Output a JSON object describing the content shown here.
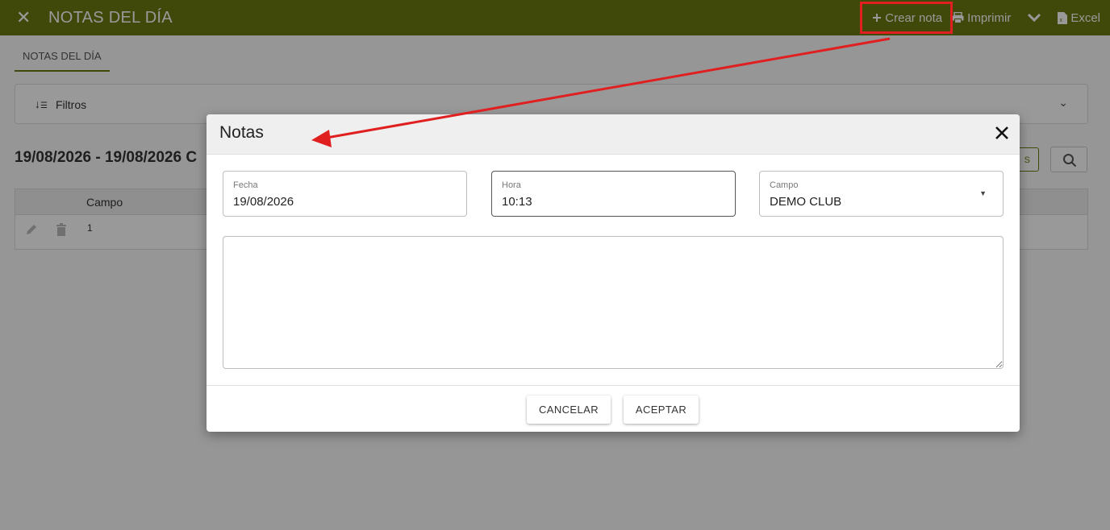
{
  "topbar": {
    "close_glyph": "✕",
    "title": "NOTAS DEL DÍA",
    "actions": [
      {
        "icon": "plus-icon",
        "label": "Crear nota"
      },
      {
        "icon": "printer-icon",
        "label": "Imprimir"
      },
      {
        "icon": "chevron-down-icon",
        "label": ""
      },
      {
        "icon": "excel-file-icon",
        "label": "Excel"
      }
    ]
  },
  "tabs": [
    {
      "label": "NOTAS DEL DÍA",
      "active": true
    }
  ],
  "filters": {
    "label": "Filtros",
    "icon": "sort-icon"
  },
  "date_range": "19/08/2026 - 19/08/2026 C",
  "partial_button_text": "S",
  "grid": {
    "columns": [
      "Campo"
    ],
    "rows": [
      {
        "value": "1"
      }
    ]
  },
  "modal": {
    "title": "Notas",
    "fields": {
      "fecha": {
        "label": "Fecha",
        "value": "19/08/2026"
      },
      "hora": {
        "label": "Hora",
        "value": "10:13"
      },
      "campo": {
        "label": "Campo",
        "value": "DEMO CLUB"
      }
    },
    "notes_value": "",
    "cancel_label": "CANCELAR",
    "accept_label": "ACEPTAR"
  },
  "colors": {
    "topbar": "#6b7a12",
    "annotation": "#e02020"
  }
}
